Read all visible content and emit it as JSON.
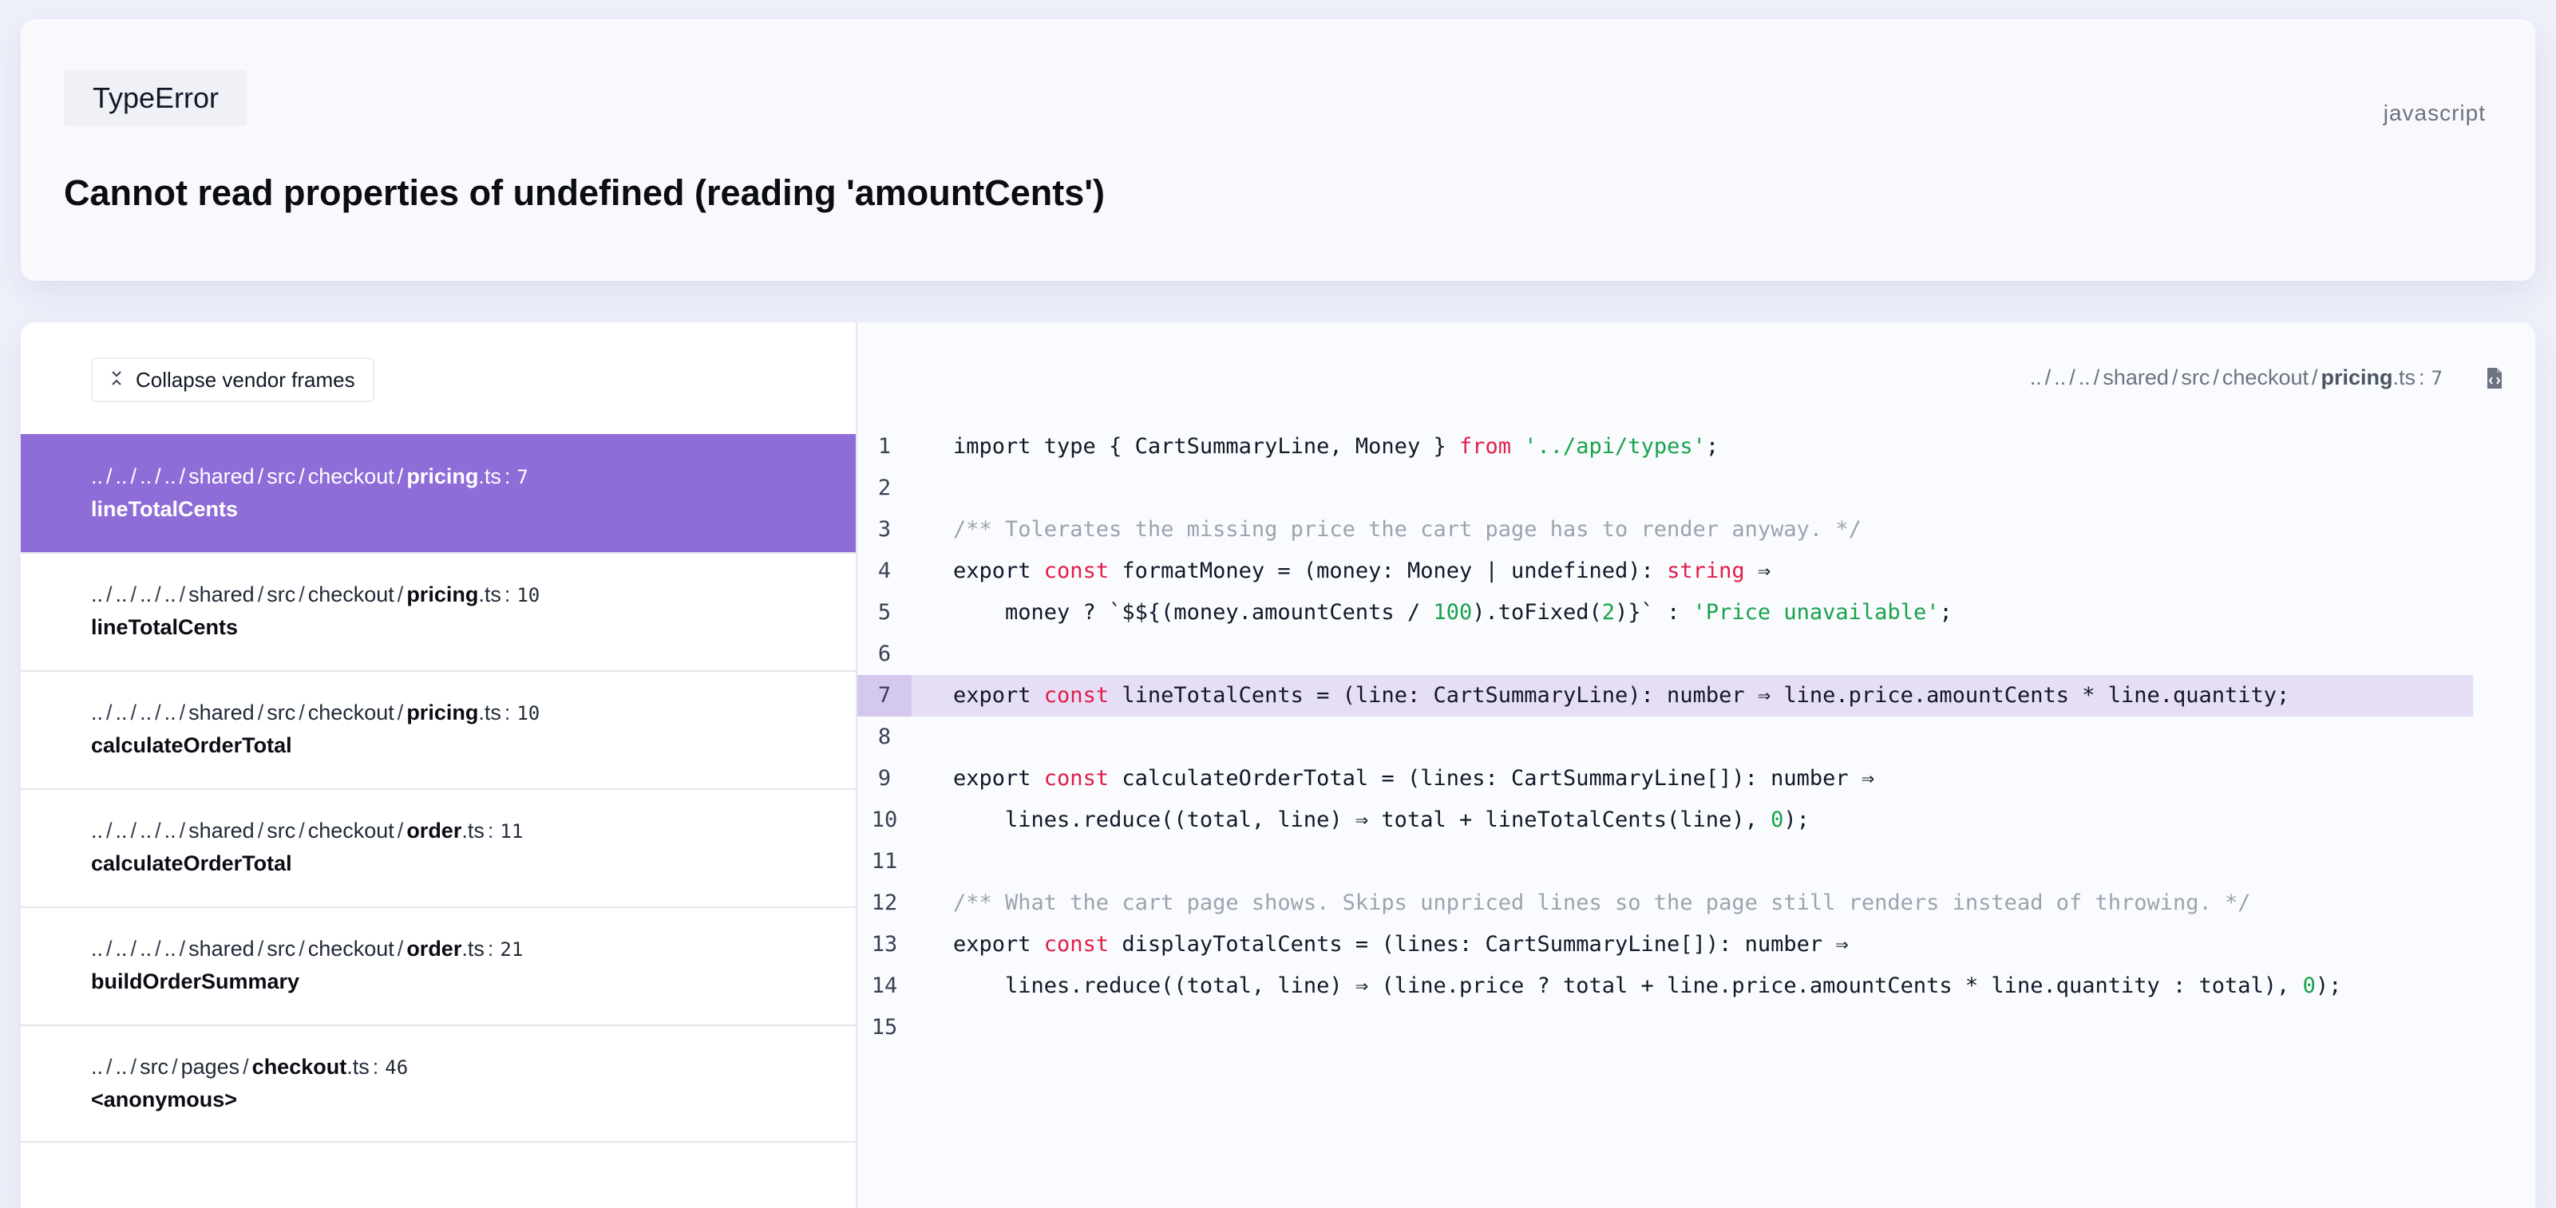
{
  "error": {
    "type": "TypeError",
    "language": "javascript",
    "message": "Cannot read properties of undefined (reading 'amountCents')"
  },
  "frames_panel": {
    "collapse_label": "Collapse vendor frames",
    "frames": [
      {
        "prefix": [
          "..",
          "..",
          "..",
          "..",
          "shared",
          "src",
          "checkout"
        ],
        "file": "pricing",
        "ext": ".ts",
        "line": "7",
        "fn": "lineTotalCents",
        "active": true
      },
      {
        "prefix": [
          "..",
          "..",
          "..",
          "..",
          "shared",
          "src",
          "checkout"
        ],
        "file": "pricing",
        "ext": ".ts",
        "line": "10",
        "fn": "lineTotalCents",
        "active": false
      },
      {
        "prefix": [
          "..",
          "..",
          "..",
          "..",
          "shared",
          "src",
          "checkout"
        ],
        "file": "pricing",
        "ext": ".ts",
        "line": "10",
        "fn": "calculateOrderTotal",
        "active": false
      },
      {
        "prefix": [
          "..",
          "..",
          "..",
          "..",
          "shared",
          "src",
          "checkout"
        ],
        "file": "order",
        "ext": ".ts",
        "line": "11",
        "fn": "calculateOrderTotal",
        "active": false
      },
      {
        "prefix": [
          "..",
          "..",
          "..",
          "..",
          "shared",
          "src",
          "checkout"
        ],
        "file": "order",
        "ext": ".ts",
        "line": "21",
        "fn": "buildOrderSummary",
        "active": false
      },
      {
        "prefix": [
          "..",
          "..",
          "src",
          "pages"
        ],
        "file": "checkout",
        "ext": ".ts",
        "line": "46",
        "fn": "<anonymous>",
        "active": false
      }
    ]
  },
  "code_panel": {
    "file_path": {
      "prefix": [
        "..",
        "..",
        "..",
        "shared",
        "src",
        "checkout"
      ],
      "file": "pricing",
      "ext": ".ts",
      "line": "7"
    },
    "open_file_icon": "file-code-icon",
    "highlighted_line": 7,
    "lines": [
      {
        "n": "1",
        "tokens": [
          [
            "",
            "import type { CartSummaryLine, Money } "
          ],
          [
            "kw",
            "from"
          ],
          [
            "",
            " "
          ],
          [
            "str",
            "'../api/types'"
          ],
          [
            "",
            ";"
          ]
        ]
      },
      {
        "n": "2",
        "tokens": []
      },
      {
        "n": "3",
        "tokens": [
          [
            "cm",
            "/** Tolerates the missing price the cart page has to render anyway. */"
          ]
        ]
      },
      {
        "n": "4",
        "tokens": [
          [
            "",
            "export "
          ],
          [
            "kw",
            "const"
          ],
          [
            "",
            " formatMoney = (money: Money | undefined): "
          ],
          [
            "kw",
            "string"
          ],
          [
            "",
            " ⇒"
          ]
        ]
      },
      {
        "n": "5",
        "tokens": [
          [
            "",
            "    money ? `$${(money.amountCents / "
          ],
          [
            "num",
            "100"
          ],
          [
            "",
            ").toFixed("
          ],
          [
            "num",
            "2"
          ],
          [
            "",
            ")}` : "
          ],
          [
            "str",
            "'Price unavailable'"
          ],
          [
            "",
            ";"
          ]
        ]
      },
      {
        "n": "6",
        "tokens": []
      },
      {
        "n": "7",
        "tokens": [
          [
            "",
            "export "
          ],
          [
            "kw",
            "const"
          ],
          [
            "",
            " lineTotalCents = (line: CartSummaryLine): number ⇒ line.price.amountCents * line.quantity;"
          ]
        ]
      },
      {
        "n": "8",
        "tokens": []
      },
      {
        "n": "9",
        "tokens": [
          [
            "",
            "export "
          ],
          [
            "kw",
            "const"
          ],
          [
            "",
            " calculateOrderTotal = (lines: CartSummaryLine[]): number ⇒"
          ]
        ]
      },
      {
        "n": "10",
        "tokens": [
          [
            "",
            "    lines.reduce((total, line) ⇒ total + lineTotalCents(line), "
          ],
          [
            "num",
            "0"
          ],
          [
            "",
            ");"
          ]
        ]
      },
      {
        "n": "11",
        "tokens": []
      },
      {
        "n": "12",
        "tokens": [
          [
            "cm",
            "/** What the cart page shows. Skips unpriced lines so the page still renders instead of throwing. */"
          ]
        ]
      },
      {
        "n": "13",
        "tokens": [
          [
            "",
            "export "
          ],
          [
            "kw",
            "const"
          ],
          [
            "",
            " displayTotalCents = (lines: CartSummaryLine[]): number ⇒"
          ]
        ]
      },
      {
        "n": "14",
        "tokens": [
          [
            "",
            "    lines.reduce((total, line) ⇒ (line.price ? total + line.price.amountCents * line.quantity : total), "
          ],
          [
            "num",
            "0"
          ],
          [
            "",
            ");"
          ]
        ]
      },
      {
        "n": "15",
        "tokens": []
      }
    ]
  },
  "colors": {
    "accent": "#8f6dd8",
    "highlight_bg": "#e6def5",
    "keyword": "#e11d48",
    "string": "#16a34a",
    "comment": "#9ca3af"
  }
}
